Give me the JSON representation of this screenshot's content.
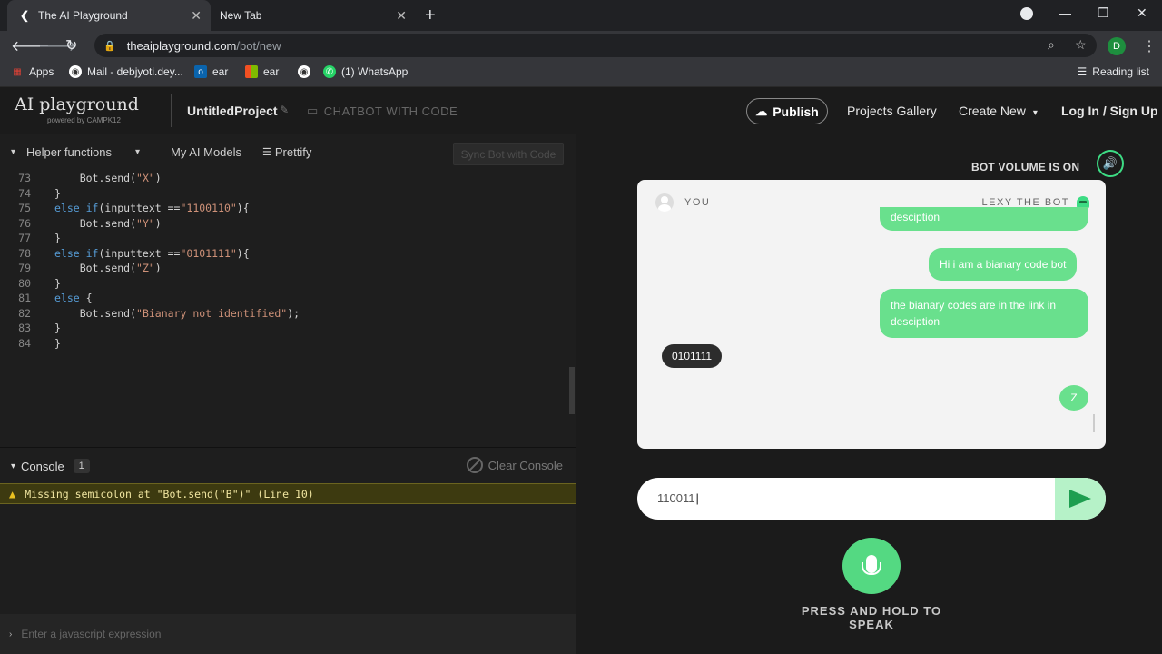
{
  "browser": {
    "tabs": [
      {
        "title": "The AI Playground",
        "active": true
      },
      {
        "title": "New Tab",
        "active": false
      }
    ],
    "url_host": "theaiplayground.com",
    "url_path": "/bot/new",
    "profile_initial": "D",
    "bookmarks": [
      "Apps",
      "Mail - debjyoti.dey...",
      "ear",
      "ear",
      "(1) WhatsApp"
    ],
    "reading_list": "Reading list"
  },
  "app": {
    "logo": "AI playground",
    "logo_sub": "powered by CAMPK12",
    "project_name": "UntitledProject",
    "mode_label": "CHATBOT WITH CODE",
    "publish_label": "Publish",
    "nav": [
      "Projects Gallery",
      "Create New",
      "Log In / Sign Up"
    ]
  },
  "editor": {
    "tools": [
      "Helper functions",
      "My AI Models",
      "Prettify"
    ],
    "sync_label": "Sync Bot with Code",
    "lines": [
      {
        "n": "73",
        "indent": 2,
        "parts": [
          [
            "i",
            "Bot.send("
          ],
          [
            "s",
            "\"X\""
          ],
          [
            "i",
            ")"
          ]
        ]
      },
      {
        "n": "74",
        "indent": 1,
        "parts": [
          [
            "i",
            "}"
          ]
        ]
      },
      {
        "n": "75",
        "indent": 1,
        "parts": [
          [
            "k",
            "else if"
          ],
          [
            "i",
            "(inputtext =="
          ],
          [
            "s",
            "\"1100110\""
          ],
          [
            "i",
            "){"
          ]
        ]
      },
      {
        "n": "76",
        "indent": 2,
        "parts": [
          [
            "i",
            "Bot.send("
          ],
          [
            "s",
            "\"Y\""
          ],
          [
            "i",
            ")"
          ]
        ]
      },
      {
        "n": "77",
        "indent": 1,
        "parts": [
          [
            "i",
            "}"
          ]
        ]
      },
      {
        "n": "78",
        "indent": 1,
        "parts": [
          [
            "k",
            "else if"
          ],
          [
            "i",
            "(inputtext =="
          ],
          [
            "s",
            "\"0101111\""
          ],
          [
            "i",
            "){"
          ]
        ]
      },
      {
        "n": "79",
        "indent": 2,
        "parts": [
          [
            "i",
            "Bot.send("
          ],
          [
            "s",
            "\"Z\""
          ],
          [
            "i",
            ")"
          ]
        ]
      },
      {
        "n": "80",
        "indent": 1,
        "parts": [
          [
            "i",
            "}"
          ]
        ]
      },
      {
        "n": "81",
        "indent": 1,
        "parts": [
          [
            "k",
            "else"
          ],
          [
            "i",
            " {"
          ]
        ]
      },
      {
        "n": "82",
        "indent": 2,
        "parts": [
          [
            "i",
            "Bot.send("
          ],
          [
            "s",
            "\"Bianary not identified\""
          ],
          [
            "i",
            ");"
          ]
        ]
      },
      {
        "n": "83",
        "indent": 1,
        "parts": [
          [
            "i",
            "}"
          ]
        ]
      },
      {
        "n": "84",
        "indent": 1,
        "parts": [
          [
            "i",
            "}"
          ]
        ]
      }
    ]
  },
  "console": {
    "title": "Console",
    "count": "1",
    "clear_label": "Clear Console",
    "warning": "Missing semicolon at \"Bot.send(\"B\")\" (Line 10)",
    "placeholder": "Enter a javascript expression"
  },
  "bot": {
    "volume_label": "BOT VOLUME IS ON",
    "user_label": "YOU",
    "bot_label": "LEXY THE BOT",
    "messages": [
      {
        "from": "bot",
        "text": "desciption"
      },
      {
        "from": "bot",
        "text": "Hi i am a bianary code bot"
      },
      {
        "from": "bot",
        "text": "the bianary codes are in the link in desciption"
      },
      {
        "from": "user",
        "text": "0101111"
      },
      {
        "from": "bot",
        "text": "Z"
      }
    ],
    "input_value": "110011",
    "press_label": "PRESS AND HOLD TO SPEAK"
  },
  "colors": {
    "accent_green": "#3ddc84",
    "bubble_green": "#69e08d",
    "warning_bg": "#3d3a10"
  }
}
